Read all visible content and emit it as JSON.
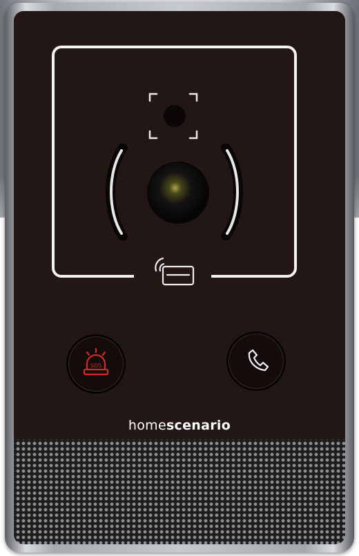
{
  "device": {
    "brand_light": "home",
    "brand_bold": "scenario"
  },
  "buttons": {
    "sos_text": "SOS",
    "sos_icon": "siren-icon",
    "call_icon": "phone-handset-icon"
  },
  "icons": {
    "card_reader": "card-reader-icon",
    "camera": "camera-lens",
    "sensor": "sensor-window"
  },
  "colors": {
    "panel": "#221715",
    "frame_line": "#f2f2f2",
    "sos_red": "#d22a22",
    "brand_text": "#ffffff"
  }
}
